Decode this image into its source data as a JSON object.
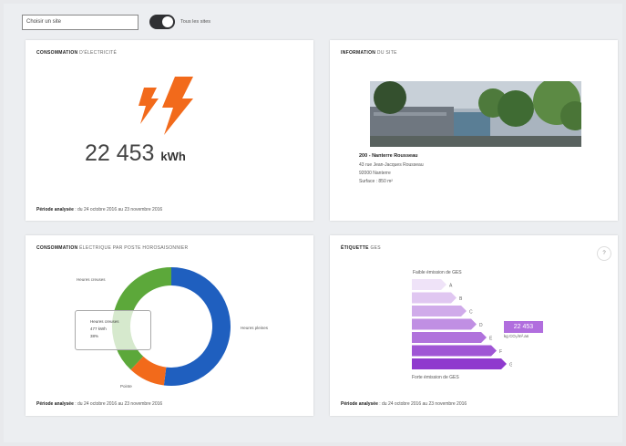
{
  "topbar": {
    "site_select": "Choisir un site",
    "toggle_label": "Tous les sites"
  },
  "electricity": {
    "title_bold": "CONSOMMATION",
    "title_rest": "D'ÉLECTRICITÉ",
    "value": "22 453",
    "unit": "kWh",
    "period_label": "Période analysée",
    "period_text": ": du 24 octobre 2016 au 23 novembre 2016"
  },
  "site_info": {
    "title_bold": "INFORMATION",
    "title_rest": "DU SITE",
    "name": "200 - Nanterre Rousseau",
    "address_1": "43 rue Jean-Jacques Rousseau",
    "address_2": "92000 Nanterre",
    "surface": "Surface : 850 m²"
  },
  "hourly": {
    "title_bold": "CONSOMMATION",
    "title_rest": "ÉLECTRIQUE PAR POSTE HOROSAISONNIER",
    "legend_top": "Heures creuses",
    "legend_right": "Heures pleines",
    "legend_bottom": "Pointe",
    "tooltip_line1": "Heures creuses",
    "tooltip_line2": "477 kWh",
    "tooltip_line3": "38%",
    "period_label": "Période analysée",
    "period_text": ": du 24 octobre 2016 au 23 novembre 2016"
  },
  "ges": {
    "title_bold": "ÉTIQUETTE",
    "title_rest": "GES",
    "low_label": "Faible émission de GES",
    "high_label": "Forte émission de GES",
    "classes": [
      "A",
      "B",
      "C",
      "D",
      "E",
      "F",
      "G"
    ],
    "value": "22 453",
    "unit": "kg CO₂/m².an",
    "help": "?",
    "period_label": "Période analysée",
    "period_text": ": du 24 octobre 2016 au 23 novembre 2016"
  },
  "chart_data": {
    "type": "pie",
    "categories": [
      "Heures pleines",
      "Pointe",
      "Heures creuses"
    ],
    "values": [
      52,
      10,
      38
    ],
    "colors": [
      "#1f5fbf",
      "#f26a1b",
      "#5ca83a"
    ]
  },
  "colors": {
    "lightning": "#f26a1b",
    "ges_purple": "#9b4fc9"
  }
}
